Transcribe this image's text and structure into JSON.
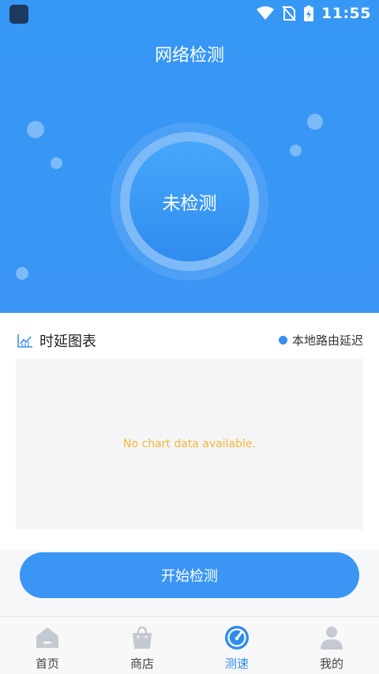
{
  "status_bar": {
    "time": "11:55"
  },
  "header": {
    "title": "网络检测"
  },
  "gauge": {
    "status": "未检测"
  },
  "chart_card": {
    "title": "时延图表",
    "legend": "本地路由延迟",
    "empty_message": "No chart data available."
  },
  "actions": {
    "start_label": "开始检测"
  },
  "tabs": [
    {
      "label": "首页",
      "icon": "home-icon"
    },
    {
      "label": "商店",
      "icon": "shopping-bag-icon"
    },
    {
      "label": "测速",
      "icon": "speedometer-icon"
    },
    {
      "label": "我的",
      "icon": "user-icon"
    }
  ],
  "colors": {
    "primary": "#3a95f4",
    "empty_text": "#f4b63a",
    "tab_active": "#2f8cee",
    "tab_inactive_icon": "#c5c9d2"
  }
}
